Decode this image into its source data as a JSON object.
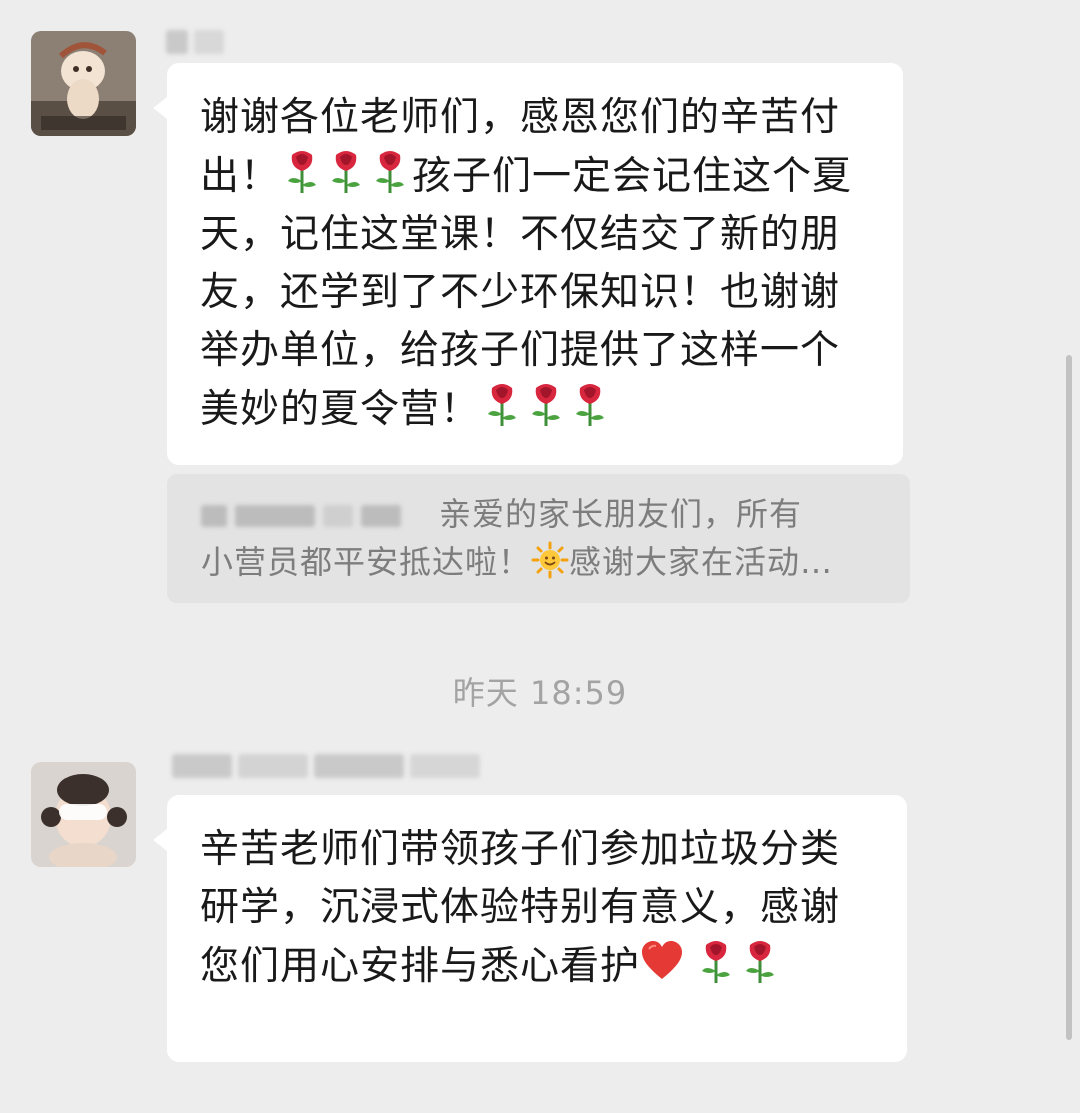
{
  "messages": [
    {
      "sender": "",
      "text_parts": [
        "谢谢各位老师们，感恩您们的辛苦付出！",
        "孩子们一定会记住这个夏天，记住这堂课！不仅结交了新的朋友，还学到了不少环保知识！也谢谢举办单位，给孩子们提供了这样一个美妙的夏令营！"
      ],
      "emojis": [
        "rose-icon",
        "rose-icon",
        "rose-icon",
        "rose-icon",
        "rose-icon",
        "rose-icon"
      ]
    },
    {
      "sender": "",
      "text": "辛苦老师们带领孩子们参加垃圾分类研学，沉浸式体验特别有意义，感谢您们用心安排与悉心看护",
      "emojis": [
        "heart-icon",
        "rose-icon",
        "rose-icon"
      ]
    }
  ],
  "quote": {
    "line1": "亲爱的家长朋友们，所有",
    "line2_a": "小营员都平安抵达啦！",
    "line2_b": "感谢大家在活动…",
    "emoji": "sun-icon"
  },
  "timestamp": "昨天 18:59",
  "colors": {
    "background": "#ededed",
    "bubble": "#ffffff",
    "quote_bg": "#e3e3e3",
    "quote_text": "#7d7d7d",
    "timestamp_text": "#a3a3a3"
  }
}
